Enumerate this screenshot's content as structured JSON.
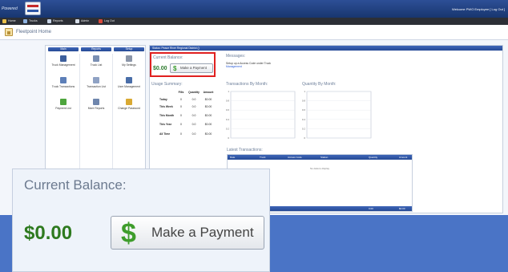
{
  "app": {
    "logo_text": "Powered",
    "welcome": "Welcome PWO Employee [ Log Out ]"
  },
  "nav": [
    {
      "label": "Home",
      "icon": "home-icon",
      "color": "#e9c04b"
    },
    {
      "label": "Trucks",
      "icon": "truck-icon",
      "color": "#8fb3e0"
    },
    {
      "label": "Reports",
      "icon": "reports-icon",
      "color": "#c8d4e6"
    },
    {
      "label": "Admin",
      "icon": "admin-icon",
      "color": "#d6dde8"
    },
    {
      "label": "Log Out",
      "icon": "logout-icon",
      "color": "#d94a3b"
    }
  ],
  "page": {
    "title": "Fleetpoint Home"
  },
  "panel": {
    "columns": [
      "Main",
      "Reports",
      "Setup"
    ],
    "main": [
      "Truck Management",
      "Truck Transactions",
      "Payment List"
    ],
    "reports": [
      "Truck List",
      "Transaction List",
      "More Reports"
    ],
    "setup": [
      "My Settings",
      "User Management",
      "Change Password"
    ]
  },
  "content": {
    "header": "Status: Peace River Regional District ()",
    "current_balance_label": "Current Balance:",
    "balance": "$0.00",
    "pay_button": "Make a Payment",
    "messages_label": "Messages:",
    "messages_text": "Setup up a Access Code under Truck",
    "messages_link": "Management"
  },
  "usage": {
    "title": "Usage Summary:",
    "columns": [
      "Fills",
      "Quantity",
      "Amount"
    ],
    "rows": [
      {
        "label": "Today",
        "fills": "0",
        "quantity": "0.0",
        "amount": "$0.00"
      },
      {
        "label": "This Week",
        "fills": "0",
        "quantity": "0.0",
        "amount": "$0.00"
      },
      {
        "label": "This Month",
        "fills": "0",
        "quantity": "0.0",
        "amount": "$0.00"
      },
      {
        "label": "This Year",
        "fills": "0",
        "quantity": "0.0",
        "amount": "$0.00"
      },
      {
        "label": "All Time",
        "fills": "0",
        "quantity": "0.0",
        "amount": "$0.00"
      }
    ]
  },
  "charts": {
    "transactions_title": "Transactions By Month:",
    "quantity_title": "Quantity By Month:",
    "yticks": [
      "1",
      "0.8",
      "0.6",
      "0.4",
      "0.2",
      "0"
    ]
  },
  "transactions": {
    "title": "Latest Transactions:",
    "columns": [
      "Date",
      "Truck",
      "Access Code",
      "Station",
      "Quantity",
      "Amount"
    ],
    "empty": "No data to display",
    "footer_quantity": "0.00",
    "footer_amount": "$0.00"
  },
  "inset": {
    "title": "Current Balance:",
    "amount": "$0.00",
    "button": "Make a Payment"
  },
  "colors": {
    "accent": "#254a95",
    "balance_green": "#2e7a1f",
    "highlight_red": "#e0201f"
  }
}
